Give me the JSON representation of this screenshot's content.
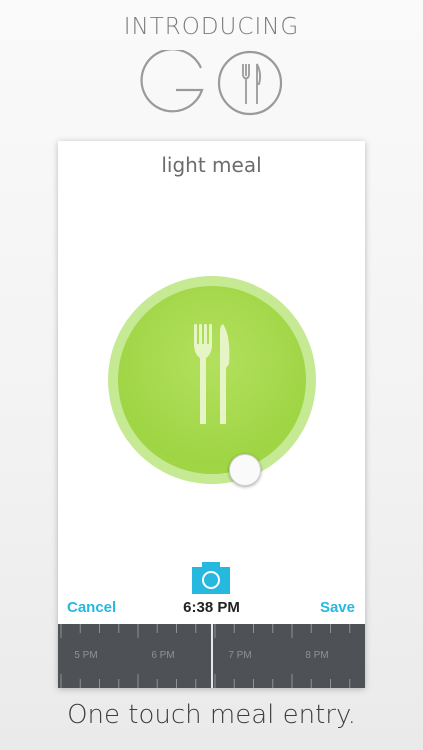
{
  "header": {
    "intro_text": "INTRODUCING",
    "logo_text": "GO"
  },
  "meal": {
    "title": "light meal",
    "plate_color": "#9fd544",
    "cutlery_icon": "fork-knife-icon"
  },
  "entry": {
    "camera_icon": "camera-icon",
    "cancel_label": "Cancel",
    "time": "6:38 PM",
    "save_label": "Save"
  },
  "timeline": {
    "labels": [
      "5 PM",
      "6 PM",
      "7 PM",
      "8 PM"
    ]
  },
  "caption": "One touch meal entry.",
  "colors": {
    "accent": "#27b8e0",
    "timeline_bg": "#4e5257"
  }
}
